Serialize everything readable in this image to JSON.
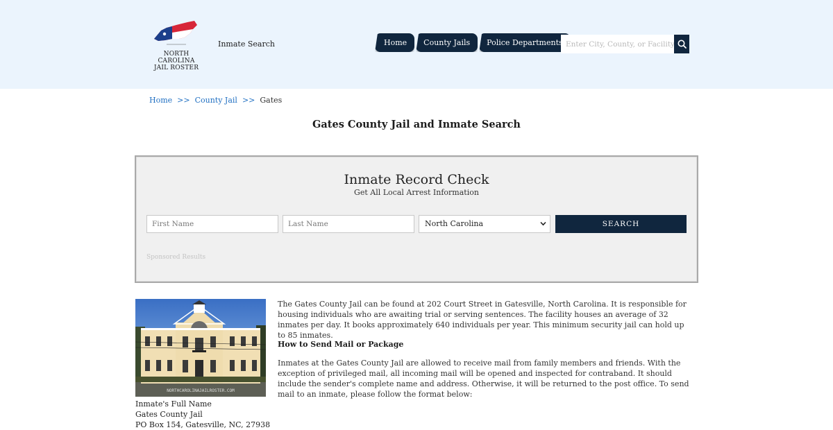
{
  "header": {
    "logo_line1": "NORTH CAROLINA",
    "logo_line2": "JAIL ROSTER",
    "inmate_search_label": "Inmate Search",
    "nav": [
      "Home",
      "County Jails",
      "Police Departments"
    ],
    "search_placeholder": "Enter City, County, or Facility",
    "icons": {
      "search": "search-icon"
    },
    "colors": {
      "nav_bg": "#10263e",
      "header_bg": "#ebf4fd",
      "link": "#1f6fc2"
    }
  },
  "breadcrumb": {
    "home": "Home",
    "sep1": ">>",
    "county": "County Jail",
    "sep2": ">>",
    "current": "Gates"
  },
  "page_title": "Gates County Jail and Inmate Search",
  "record_check": {
    "title": "Inmate Record Check",
    "subtitle": "Get All Local Arrest Information",
    "first_name_placeholder": "First Name",
    "last_name_placeholder": "Last Name",
    "state_selected": "North Carolina",
    "search_label": "SEARCH",
    "sponsored": "Sponsored Results"
  },
  "photo": {
    "watermark": "NORTHCAROLINAJAILROSTER.COM"
  },
  "address": {
    "line1": "Inmate's Full Name",
    "line2": "Gates County Jail",
    "line3": "PO Box 154, Gatesville, NC, 27938"
  },
  "article": {
    "intro": "The Gates County Jail can be found at 202 Court Street in Gatesville, North Carolina. It is responsible for housing individuals who are awaiting trial or serving sentences. The facility houses an average of 32 inmates per day. It books approximately 640 individuals per year. This minimum security jail can hold up to 85 inmates.",
    "mail_heading": "How to Send Mail or Package",
    "mail_text": "Inmates at the Gates County Jail are allowed to receive mail from family members and friends. With the exception of privileged mail, all incoming mail will be opened and inspected for contraband. It should include the sender's complete name and address. Otherwise, it will be returned to the post office. To send mail to an inmate, please follow the format below:"
  }
}
